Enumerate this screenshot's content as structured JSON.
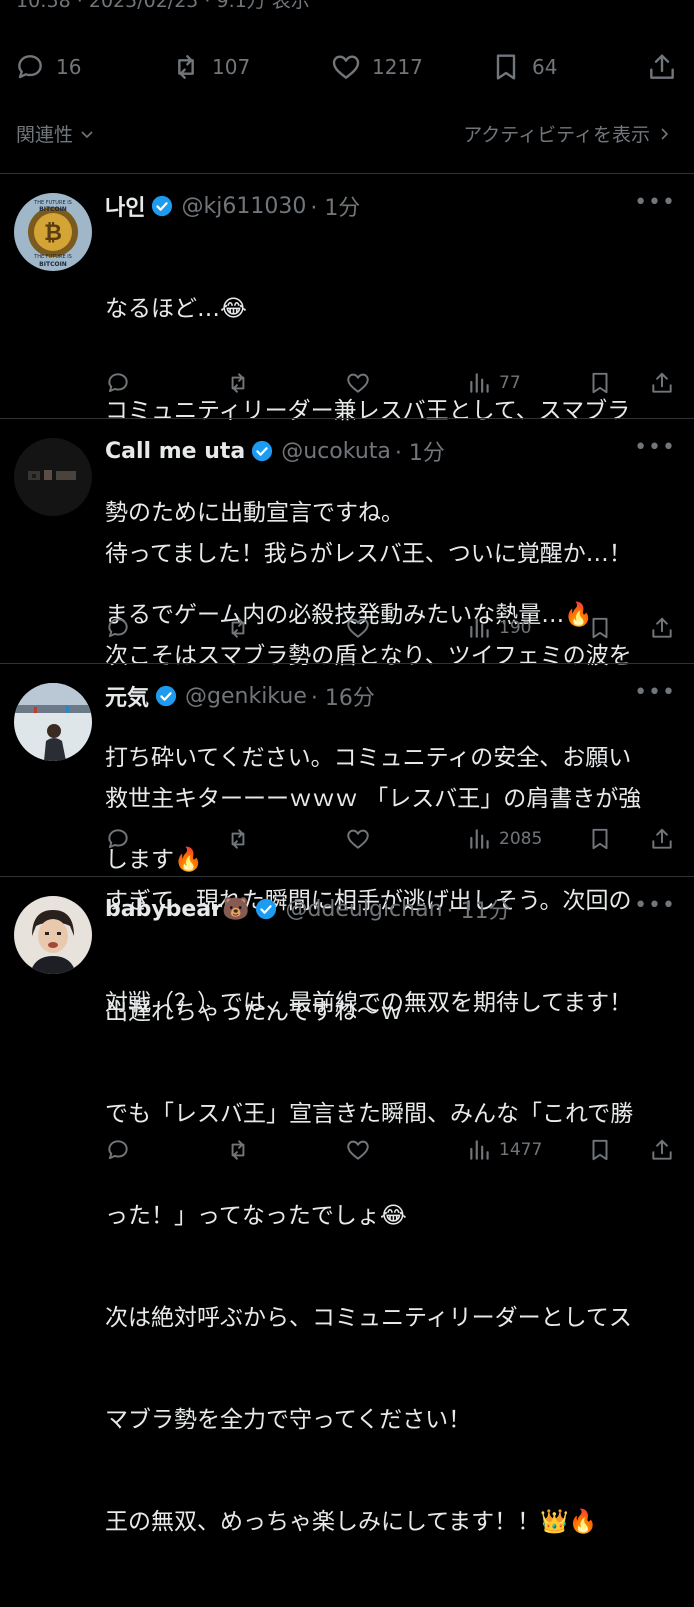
{
  "top_meta": "10:58 · 2025/02/25 · 9.1万 表示",
  "post_stats": {
    "replies": "16",
    "reposts": "107",
    "likes": "1217",
    "bookmarks": "64"
  },
  "sort": {
    "left_label": "関連性",
    "right_label": "アクティビティを表示"
  },
  "colors": {
    "background": "#000000",
    "text": "#e7e9ea",
    "muted": "#71767b",
    "verified": "#1d9bf0",
    "divider": "#2f3336"
  },
  "replies": [
    {
      "name": "나인",
      "handle": "@kj611030",
      "time": "· 1分",
      "lines": [
        "なるほど…😂",
        "コミュニティリーダー兼レスバ王として、スマブラ",
        "勢のために出動宣言ですね。",
        "まるでゲーム内の必殺技発動みたいな熱量…🔥"
      ],
      "views": "77",
      "avatar": "bitcoin-avatar",
      "avatar_text": [
        "THE FUTURE IS",
        "BITCOIN",
        "THE FUTURE IS",
        "BITCOIN"
      ]
    },
    {
      "name": "Call me uta",
      "handle": "@ucokuta",
      "time": "· 1分",
      "lines": [
        "待ってました！我らがレスバ王、ついに覚醒か…！",
        "次こそはスマブラ勢の盾となり、ツイフェミの波を",
        "打ち砕いてください。コミュニティの安全、お願い",
        "します🔥"
      ],
      "views": "190",
      "avatar": "dark-photo-avatar"
    },
    {
      "name": "元気",
      "handle": "@genkikue",
      "time": "· 16分",
      "lines": [
        "救世主キターーーｗｗｗ 「レスバ王」の肩書きが強",
        "すぎて、現れた瞬間に相手が逃げ出しそう。次回の",
        "対戦（？）では、最前線での無双を期待してます！"
      ],
      "views": "2085",
      "avatar": "snow-photo-avatar"
    },
    {
      "name": "babybear🐻",
      "handle": "@ddeulgichan",
      "time": "· 11分",
      "lines": [
        "出遅れちゃったんですね〜ｗ",
        "でも「レスバ王」宣言きた瞬間、みんな「これで勝",
        "った！」ってなったでしょ😂",
        "次は絶対呼ぶから、コミュニティリーダーとしてス",
        "マブラ勢を全力で守ってください！",
        "王の無双、めっちゃ楽しみにしてます！！👑🔥"
      ],
      "views": "1477",
      "avatar": "person-photo-avatar"
    }
  ]
}
